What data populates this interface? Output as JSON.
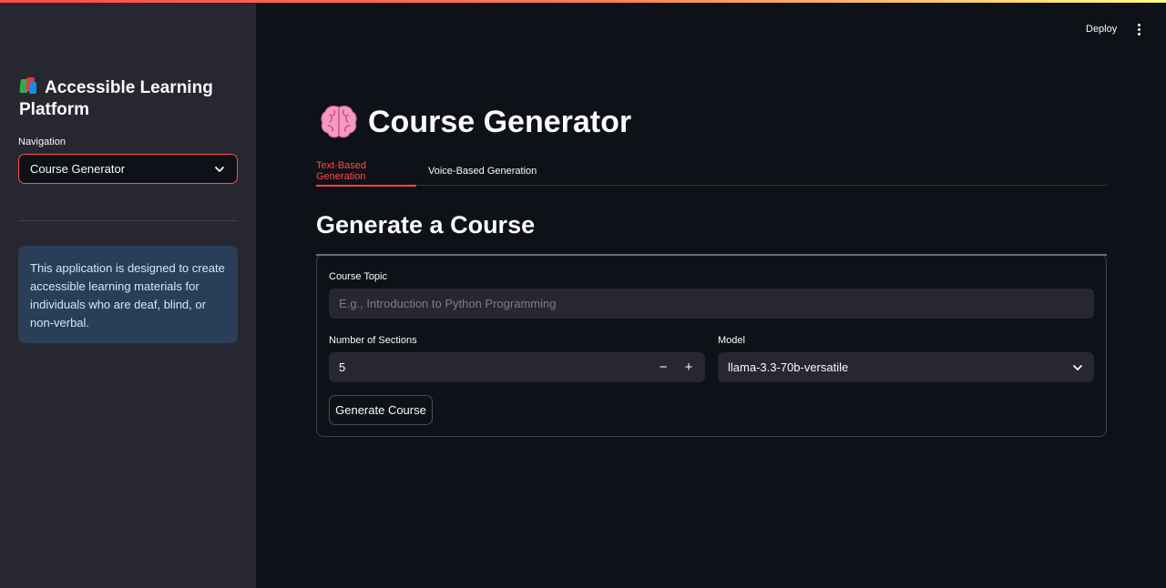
{
  "header": {
    "deploy_label": "Deploy",
    "menu_icon": "kebab-menu-icon"
  },
  "sidebar": {
    "title": "Accessible Learning Platform",
    "title_icon": "books-icon",
    "nav_label": "Navigation",
    "nav_selected": "Course Generator",
    "info_text": "This application is designed to create accessible learning materials for individuals who are deaf, blind, or non-verbal."
  },
  "main": {
    "title": "Course Generator",
    "title_icon": "brain-icon",
    "tabs": [
      {
        "label": "Text-Based Generation",
        "active": true
      },
      {
        "label": "Voice-Based Generation",
        "active": false
      }
    ],
    "section_title": "Generate a Course",
    "form": {
      "topic_label": "Course Topic",
      "topic_placeholder": "E.g., Introduction to Python Programming",
      "sections_label": "Number of Sections",
      "sections_value": "5",
      "decrement": "−",
      "increment": "+",
      "model_label": "Model",
      "model_value": "llama-3.3-70b-versatile",
      "submit_label": "Generate Course"
    }
  },
  "colors": {
    "accent": "#ff4b4b",
    "background": "#0e1117",
    "sidebar": "#262730",
    "info_bg": "#1c3a5e"
  }
}
